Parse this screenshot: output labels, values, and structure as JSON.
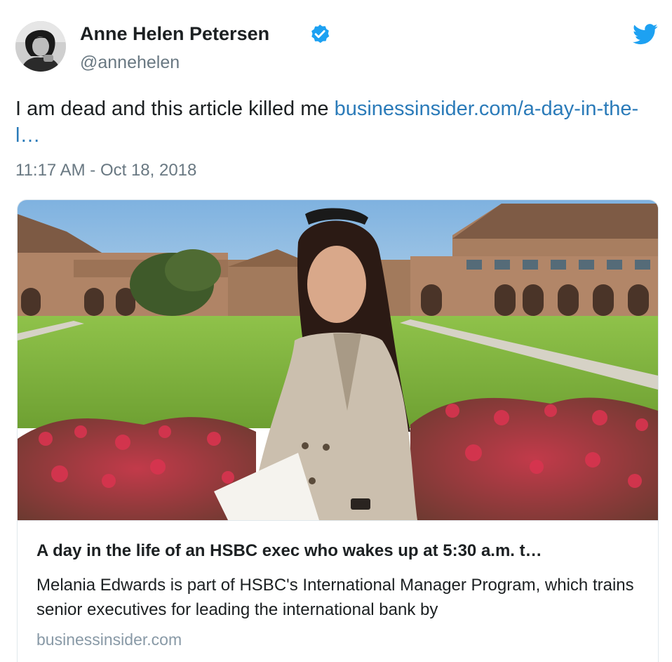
{
  "author": {
    "name": "Anne Helen Petersen",
    "handle": "@annehelen",
    "verified": true
  },
  "tweet": {
    "text": "I am dead and this article killed me ",
    "link_text": "businessinsider.com/a-day-in-the-l…",
    "timestamp": "11:17 AM - Oct 18, 2018"
  },
  "card": {
    "title": "A day in the life of an HSBC exec who wakes up at 5:30 a.m. t…",
    "description": "Melania Edwards is part of HSBC's International Manager Program, which trains senior executives for leading the international bank by",
    "domain": "businessinsider.com",
    "image": "photo-woman-in-trench-coat-campus-lawn"
  },
  "icons": {
    "verified": "verified-badge-icon",
    "brand": "twitter-bird-icon"
  },
  "colors": {
    "link": "#2b7bb9",
    "muted": "#697882",
    "verified": "#1da1f2",
    "brand": "#1da1f2",
    "border": "#e1e8ed"
  }
}
